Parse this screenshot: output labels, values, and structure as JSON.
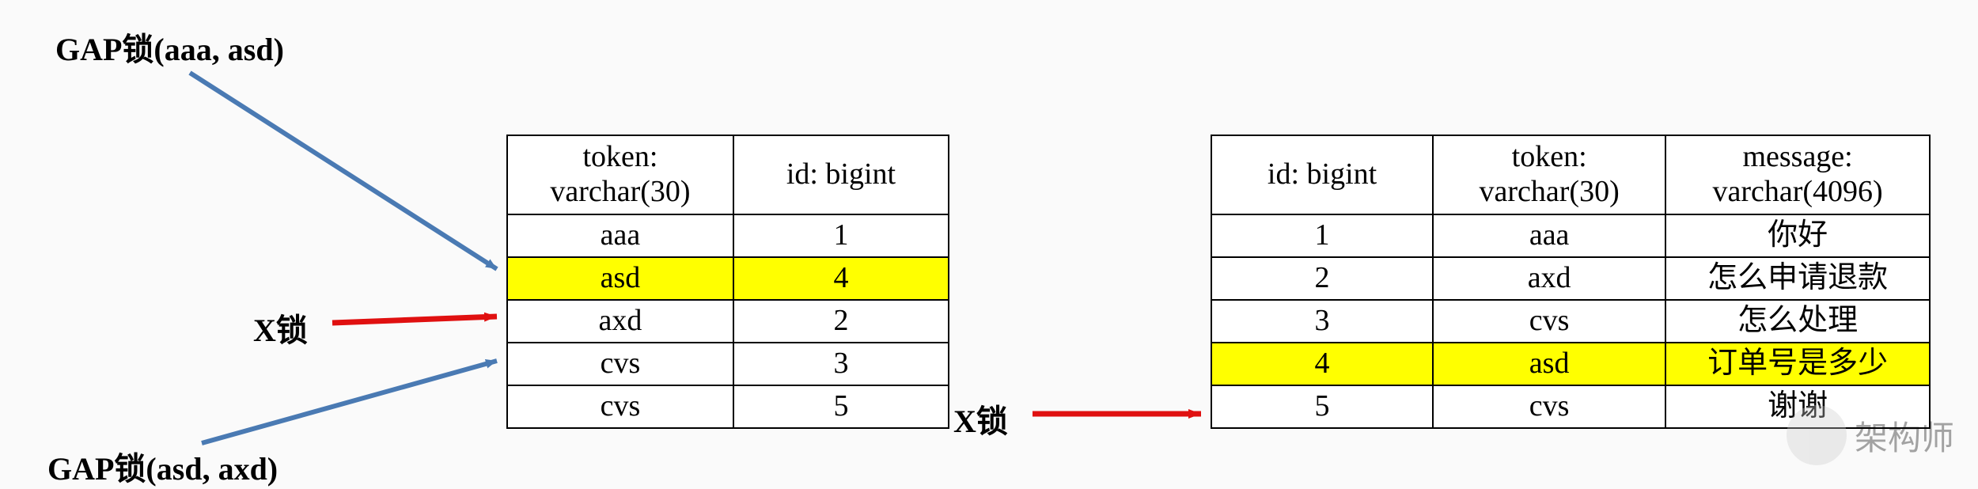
{
  "labels": {
    "gap1": "GAP锁(aaa, asd)",
    "gap2": "GAP锁(asd, axd)",
    "xlock_left": "X锁",
    "xlock_right": "X锁"
  },
  "table_left": {
    "headers": {
      "col0_line1": "token:",
      "col0_line2": "varchar(30)",
      "col1_line1": "id: bigint"
    },
    "rows": [
      {
        "token": "aaa",
        "id": "1",
        "hl": false
      },
      {
        "token": "asd",
        "id": "4",
        "hl": true
      },
      {
        "token": "axd",
        "id": "2",
        "hl": false
      },
      {
        "token": "cvs",
        "id": "3",
        "hl": false
      },
      {
        "token": "cvs",
        "id": "5",
        "hl": false
      }
    ]
  },
  "table_right": {
    "headers": {
      "col0_line1": "id: bigint",
      "col1_line1": "token:",
      "col1_line2": "varchar(30)",
      "col2_line1": "message:",
      "col2_line2": "varchar(4096)"
    },
    "rows": [
      {
        "id": "1",
        "token": "aaa",
        "message": "你好",
        "hl": false
      },
      {
        "id": "2",
        "token": "axd",
        "message": "怎么申请退款",
        "hl": false
      },
      {
        "id": "3",
        "token": "cvs",
        "message": "怎么处理",
        "hl": false
      },
      {
        "id": "4",
        "token": "asd",
        "message": "订单号是多少",
        "hl": true
      },
      {
        "id": "5",
        "token": "cvs",
        "message": "谢谢",
        "hl": false
      }
    ]
  },
  "watermark": "架构师"
}
